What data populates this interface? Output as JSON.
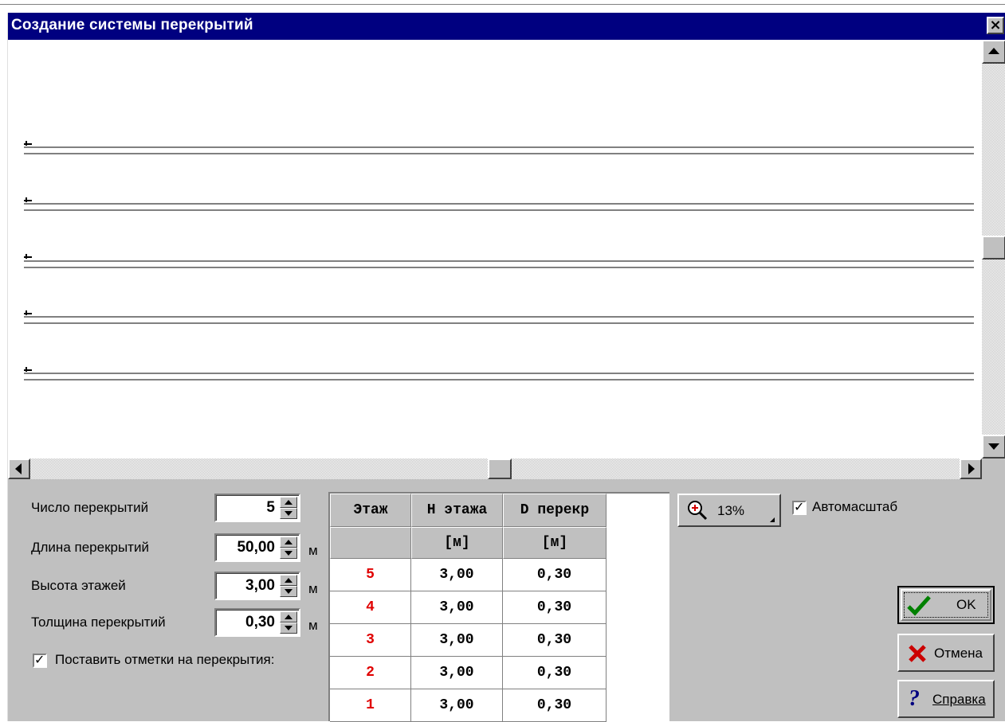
{
  "window": {
    "title": "Создание системы перекрытий",
    "close_label": "×"
  },
  "params": {
    "count_label": "Число перекрытий",
    "count_value": "5",
    "length_label": "Длина перекрытий",
    "length_value": "50,00",
    "height_label": "Высота этажей",
    "height_value": "3,00",
    "thickness_label": "Толщина перекрытий",
    "thickness_value": "0,30",
    "unit": "м",
    "marks_label": "Поставить отметки на перекрытия:",
    "marks_checked": true
  },
  "table": {
    "headers": [
      "Этаж",
      "H этажа",
      "D перекр"
    ],
    "units": [
      "",
      "[м]",
      "[м]"
    ],
    "rows": [
      {
        "floor": "5",
        "h": "3,00",
        "d": "0,30"
      },
      {
        "floor": "4",
        "h": "3,00",
        "d": "0,30"
      },
      {
        "floor": "3",
        "h": "3,00",
        "d": "0,30"
      },
      {
        "floor": "2",
        "h": "3,00",
        "d": "0,30"
      },
      {
        "floor": "1",
        "h": "3,00",
        "d": "0,30"
      }
    ]
  },
  "zoom": {
    "value": "13%",
    "icon": "zoom-in-icon"
  },
  "autoscale": {
    "label": "Автомасштаб",
    "checked": true
  },
  "buttons": {
    "ok": "OK",
    "cancel": "Отмена",
    "help": "Справка"
  },
  "colors": {
    "titlebar": "#000080",
    "dialog": "#c0c0c0",
    "floor_number": "#e00000",
    "ok_check": "#008000",
    "cancel_x": "#cc0000",
    "help_q": "#000080"
  }
}
